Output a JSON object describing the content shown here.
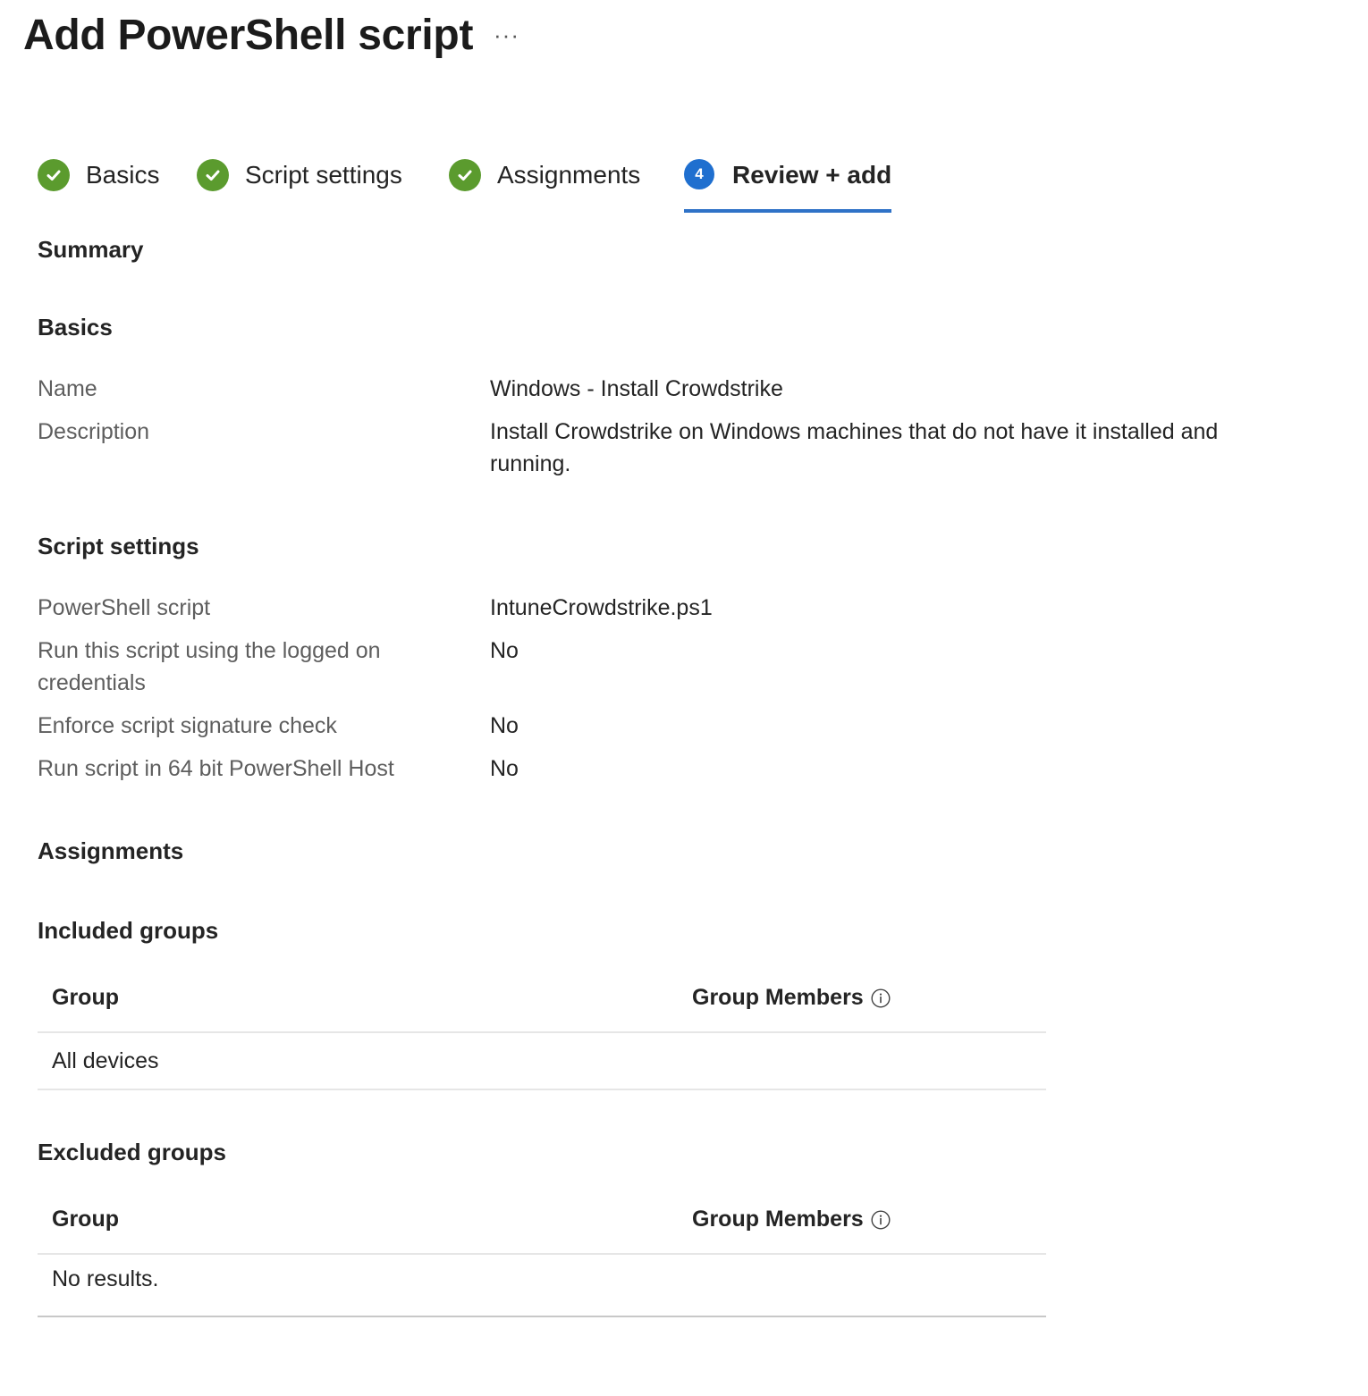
{
  "header": {
    "title": "Add PowerShell script",
    "more_label": "···"
  },
  "steps": [
    {
      "label": "Basics",
      "state": "complete",
      "icon": "check-circle-icon"
    },
    {
      "label": "Script settings",
      "state": "complete",
      "icon": "check-circle-icon"
    },
    {
      "label": "Assignments",
      "state": "complete",
      "icon": "check-circle-icon"
    },
    {
      "label": "Review + add",
      "state": "active",
      "number": "4"
    }
  ],
  "summary": {
    "heading": "Summary"
  },
  "basics": {
    "heading": "Basics",
    "name_label": "Name",
    "name_value": "Windows - Install Crowdstrike",
    "description_label": "Description",
    "description_value": "Install Crowdstrike on Windows machines that do not have it installed and running."
  },
  "script_settings": {
    "heading": "Script settings",
    "script_label": "PowerShell script",
    "script_value": "IntuneCrowdstrike.ps1",
    "logged_on_label": "Run this script using the logged on credentials",
    "logged_on_value": "No",
    "signature_label": "Enforce script signature check",
    "signature_value": "No",
    "host64_label": "Run script in 64 bit PowerShell Host",
    "host64_value": "No"
  },
  "assignments": {
    "heading": "Assignments",
    "included": {
      "heading": "Included groups",
      "col_group": "Group",
      "col_members": "Group Members",
      "rows": [
        "All devices"
      ]
    },
    "excluded": {
      "heading": "Excluded groups",
      "col_group": "Group",
      "col_members": "Group Members",
      "empty_text": "No results."
    }
  },
  "colors": {
    "complete": "#5b9b2e",
    "active": "#1f6fcf",
    "active_underline": "#2f72c7"
  }
}
